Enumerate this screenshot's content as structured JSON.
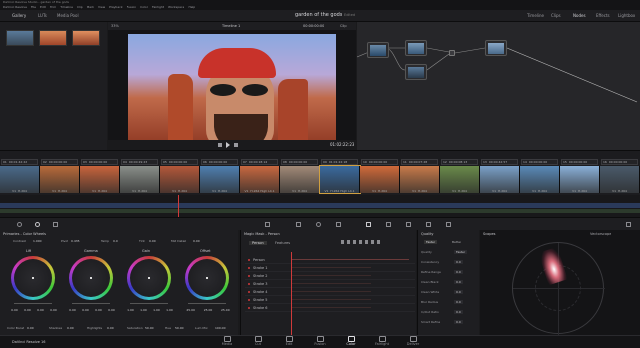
{
  "app": {
    "window_title": "DaVinci Resolve Studio - garden of the gods",
    "menu": [
      "DaVinci Resolve",
      "File",
      "Edit",
      "Trim",
      "Timeline",
      "Clip",
      "Mark",
      "View",
      "Playback",
      "Fusion",
      "Color",
      "Fairlight",
      "Workspace",
      "Help"
    ],
    "project_title": "garden of the gods",
    "edited_badge": "Edited",
    "product": "DaVinci Resolve 16"
  },
  "topbar": {
    "gallery": "Gallery",
    "luts": "LUTs",
    "media_pool": "Media Pool",
    "timeline": "Timeline",
    "clips": "Clips",
    "nodes": "Nodes",
    "effects": "Effects",
    "lightbox": "Lightbox"
  },
  "viewer": {
    "zoom": "33%",
    "timeline_name": "Timeline 1",
    "timecode_top": "00:00:00:00",
    "timecode_current": "01:02:22:23",
    "label_clip": "Clip"
  },
  "clips": [
    {
      "num": "01",
      "tc": "00:01:42:22",
      "track": "V1",
      "codec": "H.264",
      "color": "#4a6a8a"
    },
    {
      "num": "02",
      "tc": "00:00:00:00",
      "track": "V1",
      "codec": "H.264",
      "color": "#b86a3a"
    },
    {
      "num": "03",
      "tc": "00:00:00:00",
      "track": "V1",
      "codec": "H.264",
      "color": "#c8643c"
    },
    {
      "num": "04",
      "tc": "00:00:29:23",
      "track": "V1",
      "codec": "H.264",
      "color": "#8a8f8a"
    },
    {
      "num": "05",
      "tc": "00:00:00:00",
      "track": "V1",
      "codec": "H.264",
      "color": "#b4583a"
    },
    {
      "num": "06",
      "tc": "00:00:00:00",
      "track": "V1",
      "codec": "H.264",
      "color": "#4f7fb0"
    },
    {
      "num": "07",
      "tc": "00:00:18:14",
      "track": "V1",
      "codec": "H.264 High L4.1",
      "color": "#c86840"
    },
    {
      "num": "08",
      "tc": "00:00:00:00",
      "track": "V1",
      "codec": "H.264",
      "color": "#a28a78"
    },
    {
      "num": "09",
      "tc": "01:01:22:18",
      "track": "V1",
      "codec": "H.264 High L4.1",
      "color": "#3a6a9e"
    },
    {
      "num": "10",
      "tc": "00:00:00:00",
      "track": "V1",
      "codec": "H.264",
      "color": "#d06a3a"
    },
    {
      "num": "11",
      "tc": "00:00:07:28",
      "track": "V1",
      "codec": "H.264",
      "color": "#c87a4a"
    },
    {
      "num": "12",
      "tc": "00:00:08:13",
      "track": "V1",
      "codec": "H.264",
      "color": "#6a8a4a"
    },
    {
      "num": "13",
      "tc": "00:00:42:57",
      "track": "V1",
      "codec": "H.264",
      "color": "#7aa0c8"
    },
    {
      "num": "14",
      "tc": "00:00:00:00",
      "track": "V1",
      "codec": "H.264",
      "color": "#5a8ab8"
    },
    {
      "num": "15",
      "tc": "00:00:00:00",
      "track": "V1",
      "codec": "H.264",
      "color": "#8ab0d8"
    },
    {
      "num": "16",
      "tc": "00:00:00:00",
      "track": "V1",
      "codec": "H.264",
      "color": "#4a5a6a"
    }
  ],
  "color_wheels": {
    "section_title": "Primaries - Color Wheels",
    "contrast_label": "Contrast",
    "contrast": "1.000",
    "pivot_label": "Pivot",
    "pivot": "0.435",
    "sat_label": "Saturation",
    "sat": "50.00",
    "hue_label": "Hue",
    "hue": "50.00",
    "lummix_label": "Lum Mix",
    "lummix": "100.00",
    "temp_label": "Temp",
    "temp": "0.0",
    "tint_label": "Tint",
    "tint": "0.00",
    "mid_label": "Mid Detail",
    "mid": "0.00",
    "shadows_label": "Shadows",
    "shadows": "0.00",
    "highlights_label": "Highlights",
    "highlights": "0.00",
    "colorboost_label": "Color Boost",
    "colorboost": "0.00",
    "wheels": [
      {
        "name": "Lift",
        "values": [
          "0.00",
          "0.00",
          "0.00",
          "0.00"
        ],
        "hue_tint": "#2c5aa0"
      },
      {
        "name": "Gamma",
        "values": [
          "0.00",
          "0.00",
          "0.00",
          "0.00"
        ],
        "hue_tint": "#3c7a3c"
      },
      {
        "name": "Gain",
        "values": [
          "1.00",
          "1.00",
          "1.00",
          "1.00"
        ],
        "hue_tint": "#a03c3c"
      },
      {
        "name": "Offset",
        "values": [
          "25.00",
          "25.00",
          "25.00"
        ],
        "hue_tint": "#7a3ca0"
      }
    ]
  },
  "magic_mask": {
    "title": "Magic Mask - Person",
    "tab_person": "Person",
    "tab_features": "Features",
    "rows": [
      "Person",
      "Stroke 1",
      "Stroke 2",
      "Stroke 3",
      "Stroke 4",
      "Stroke 5",
      "Stroke 6"
    ]
  },
  "mask_settings": {
    "title": "Quality",
    "mode_a": "Faster",
    "mode_b": "Better",
    "label_smart": "Smart Refine",
    "keys": [
      {
        "k": "Quality",
        "v": "Faster"
      },
      {
        "k": "Consistency",
        "v": "0.0"
      },
      {
        "k": "Refine Range",
        "v": "0.0"
      },
      {
        "k": "Clean Black",
        "v": "0.0"
      },
      {
        "k": "Clean White",
        "v": "0.0"
      },
      {
        "k": "Blur Radius",
        "v": "0.0"
      },
      {
        "k": "In/Out Ratio",
        "v": "0.0"
      },
      {
        "k": "Smart Refine",
        "v": "0.0"
      }
    ]
  },
  "scopes": {
    "title": "Scopes",
    "mode": "Vectorscope"
  },
  "pages": [
    "Media",
    "Cut",
    "Edit",
    "Fusion",
    "Color",
    "Fairlight",
    "Deliver"
  ],
  "active_page": "Color"
}
